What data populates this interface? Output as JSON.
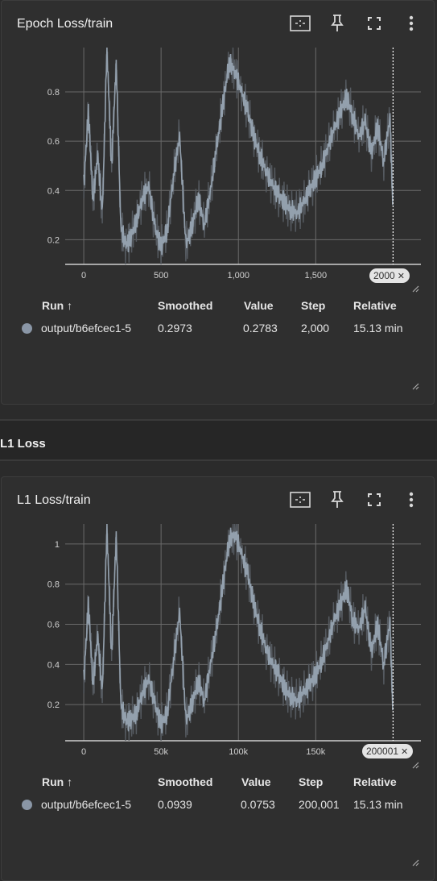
{
  "colors": {
    "background": "#2b2b2b",
    "card": "#2f2f2f",
    "series": "#93a0ad",
    "series_raw": "#555a60",
    "grid": "#6a6a6a"
  },
  "icons": [
    "fit-domain-icon",
    "pin-icon",
    "fullscreen-icon",
    "more-vert-icon",
    "resize-handle-icon",
    "close-icon"
  ],
  "cards": [
    {
      "title": "Epoch Loss/train",
      "step_chip": "2000",
      "table": {
        "headers": [
          "Run ↑",
          "Smoothed",
          "Value",
          "Step",
          "Relative"
        ],
        "row": {
          "run": "output/b6efcec1-5",
          "smoothed": "0.2973",
          "value": "0.2783",
          "step": "2,000",
          "relative": "15.13 min"
        }
      }
    },
    {
      "title": "L1 Loss/train",
      "step_chip": "200001",
      "table": {
        "headers": [
          "Run ↑",
          "Smoothed",
          "Value",
          "Step",
          "Relative"
        ],
        "row": {
          "run": "output/b6efcec1-5",
          "smoothed": "0.0939",
          "value": "0.0753",
          "step": "200,001",
          "relative": "15.13 min"
        }
      }
    }
  ],
  "section": {
    "title": "L1 Loss"
  },
  "chart_data": [
    {
      "type": "line",
      "xlim": [
        -120,
        2180
      ],
      "ylim": [
        0.1,
        0.98
      ],
      "xticks": [
        0,
        500,
        1000,
        1500
      ],
      "xtick_labels": [
        "0",
        "500",
        "1,000",
        "1,500"
      ],
      "yticks": [
        0.2,
        0.4,
        0.6,
        0.8
      ],
      "ytick_labels": [
        "0.2",
        "0.4",
        "0.6",
        "0.8"
      ],
      "marker_x": 2000,
      "series": [
        {
          "x": [
            0,
            30,
            60,
            90,
            120,
            150,
            180,
            210,
            240,
            270,
            300,
            340,
            380,
            420,
            460,
            500,
            540,
            580,
            620,
            660,
            700,
            740,
            780,
            820,
            860,
            900,
            940,
            980,
            1020,
            1060,
            1100,
            1140,
            1180,
            1220,
            1260,
            1300,
            1340,
            1380,
            1420,
            1460,
            1500,
            1540,
            1580,
            1620,
            1660,
            1700,
            1740,
            1780,
            1820,
            1860,
            1900,
            1940,
            1980,
            2000
          ],
          "y": [
            0.42,
            0.72,
            0.36,
            0.55,
            0.3,
            0.98,
            0.5,
            0.92,
            0.25,
            0.18,
            0.2,
            0.28,
            0.37,
            0.42,
            0.25,
            0.17,
            0.24,
            0.46,
            0.62,
            0.18,
            0.25,
            0.37,
            0.26,
            0.4,
            0.58,
            0.75,
            0.92,
            0.88,
            0.8,
            0.72,
            0.62,
            0.54,
            0.48,
            0.42,
            0.38,
            0.35,
            0.32,
            0.31,
            0.35,
            0.4,
            0.45,
            0.5,
            0.58,
            0.65,
            0.72,
            0.78,
            0.7,
            0.62,
            0.68,
            0.55,
            0.66,
            0.52,
            0.7,
            0.3
          ]
        }
      ]
    },
    {
      "type": "line",
      "xlim": [
        -12000,
        218000
      ],
      "ylim": [
        0.02,
        1.1
      ],
      "xticks": [
        0,
        50000,
        100000,
        150000
      ],
      "xtick_labels": [
        "0",
        "50k",
        "100k",
        "150k"
      ],
      "yticks": [
        0.2,
        0.4,
        0.6,
        0.8,
        1.0
      ],
      "ytick_labels": [
        "0.2",
        "0.4",
        "0.6",
        "0.8",
        "1"
      ],
      "marker_x": 200001,
      "series": [
        {
          "x": [
            0,
            3000,
            6000,
            9000,
            12000,
            15000,
            18000,
            21000,
            24000,
            27000,
            30000,
            34000,
            38000,
            42000,
            46000,
            50000,
            54000,
            58000,
            62000,
            66000,
            70000,
            74000,
            78000,
            82000,
            86000,
            90000,
            94000,
            98000,
            102000,
            106000,
            110000,
            114000,
            118000,
            122000,
            126000,
            130000,
            134000,
            138000,
            142000,
            146000,
            150000,
            154000,
            158000,
            162000,
            166000,
            170000,
            174000,
            178000,
            182000,
            186000,
            190000,
            194000,
            198000,
            200001
          ],
          "y": [
            0.32,
            0.7,
            0.3,
            0.55,
            0.25,
            1.08,
            0.45,
            1.05,
            0.2,
            0.12,
            0.12,
            0.16,
            0.26,
            0.33,
            0.2,
            0.1,
            0.16,
            0.42,
            0.66,
            0.12,
            0.2,
            0.32,
            0.22,
            0.4,
            0.58,
            0.8,
            1.02,
            1.05,
            0.95,
            0.85,
            0.7,
            0.58,
            0.48,
            0.4,
            0.35,
            0.28,
            0.24,
            0.22,
            0.26,
            0.3,
            0.35,
            0.42,
            0.52,
            0.62,
            0.7,
            0.78,
            0.62,
            0.58,
            0.68,
            0.46,
            0.6,
            0.4,
            0.62,
            0.12
          ]
        }
      ]
    }
  ]
}
